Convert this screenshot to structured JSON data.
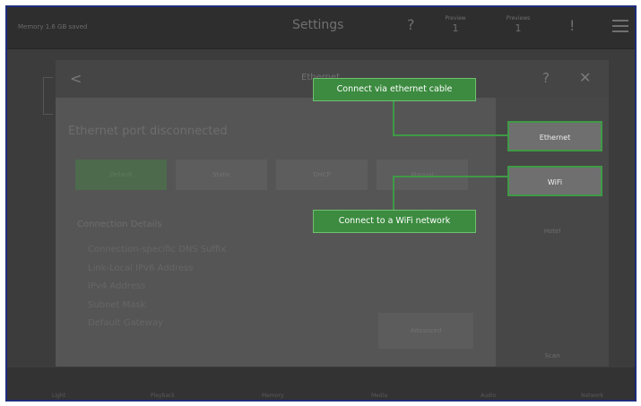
{
  "topbar": {
    "memory_status": "Memory 1.6 GB saved",
    "title": "Settings",
    "help": "?",
    "counter_left": {
      "label": "Preview",
      "value": "1"
    },
    "counter_right": {
      "label": "Previews",
      "value": "1"
    },
    "alert": "!"
  },
  "dialog": {
    "back": "<",
    "title": "Ethernet",
    "help": "?",
    "close": "✕",
    "status": "Ethernet port disconnected",
    "tabs": [
      "Default",
      "Static",
      "DHCP",
      "Manual"
    ],
    "details_heading": "Connection Details",
    "details": [
      "Connection-specific DNS Suffix",
      "Link-Local IPv6 Address",
      "IPv4 Address",
      "Subnet Mask",
      "Default Gateway"
    ],
    "advanced_label": "Advanced",
    "side": {
      "ethernet_label": "Ethernet",
      "wifi_label": "WiFi",
      "item3_label": "Hotel",
      "scan_label": "Scan"
    }
  },
  "callouts": {
    "ethernet": "Connect via ethernet cable",
    "wifi": "Connect to a WiFi network"
  },
  "bottombar": {
    "items": [
      "Light",
      "Playback",
      "Memory",
      "Media",
      "Audio",
      "Network"
    ]
  },
  "colors": {
    "highlight": "#3f9a46",
    "callout_fill": "#3c8b40",
    "overlay_dark": "#3c3c3c"
  }
}
